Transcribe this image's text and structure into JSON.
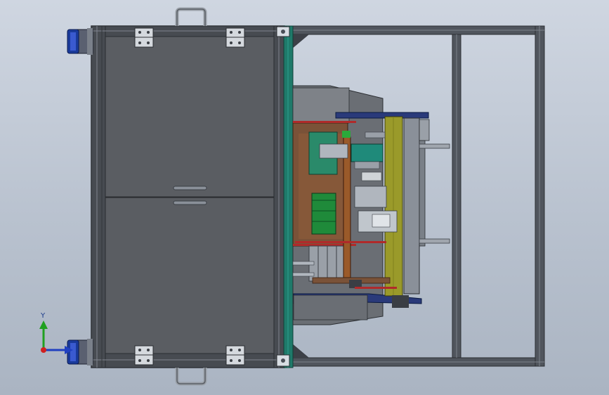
{
  "viewport": {
    "background_top": "#cfd6e1",
    "background_bottom": "#aab4c2"
  },
  "colors": {
    "frame": "#4a4f57",
    "frame_light": "#8a9099",
    "panel": "#55585d",
    "teal_rail": "#1f7a6a",
    "olive_plate": "#9a9a2a",
    "wood_plate": "#8a5a3a",
    "navy_bracket": "#2a3a7a",
    "motor_green": "#1f8a3a",
    "caster_blue": "#1a3a9a"
  },
  "triad": {
    "y_label": "Y",
    "x_color": "#d02020",
    "y_color": "#20a020",
    "z_color": "#2040c0"
  },
  "icons": [
    "coordinate-triad-icon",
    "handle-icon",
    "hinge-icon",
    "caster-icon"
  ]
}
